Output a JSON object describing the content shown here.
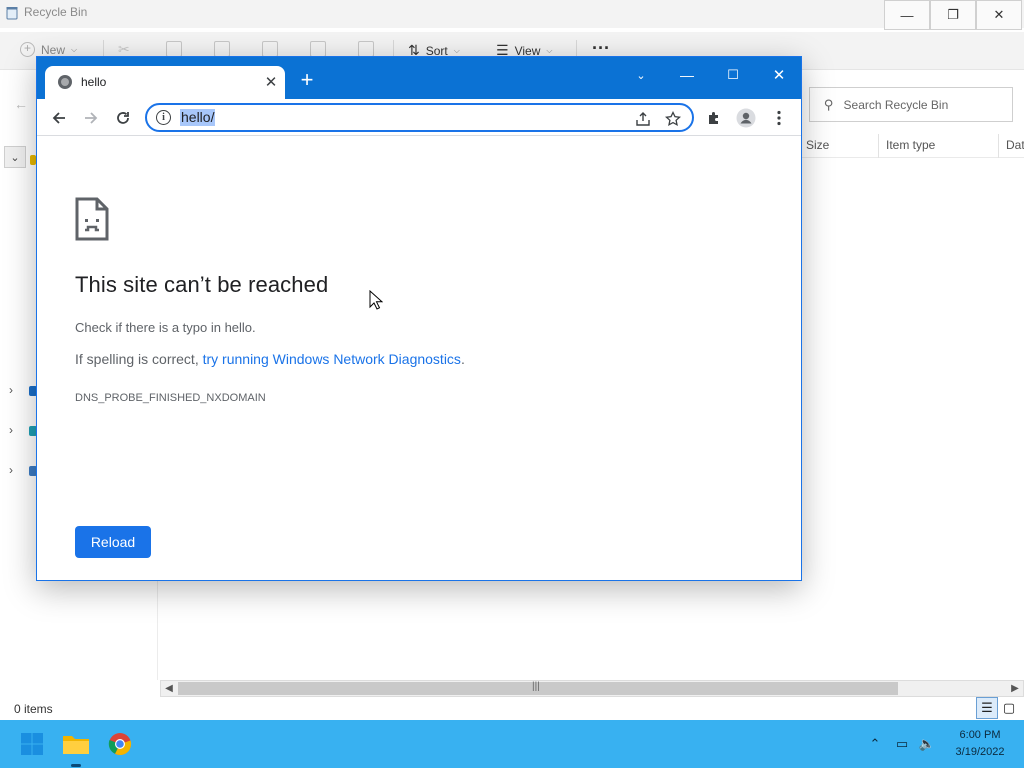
{
  "explorer": {
    "title": "Recycle Bin",
    "toolbar": {
      "new_label": "New",
      "sort_label": "Sort",
      "view_label": "View",
      "more_label": "···"
    },
    "search_placeholder": "Search Recycle Bin",
    "columns": [
      "Size",
      "Item type",
      "Dat"
    ],
    "status": "0 items"
  },
  "browser": {
    "tab_title": "hello",
    "url": "hello/",
    "accent": "#1a73e8",
    "titlebar_color": "#0b72d4"
  },
  "error": {
    "heading": "This site can’t be reached",
    "line1": "Check if there is a typo in hello.",
    "line2_prefix": "If spelling is correct, ",
    "line2_link": "try running Windows Network Diagnostics",
    "line2_suffix": ".",
    "code": "DNS_PROBE_FINISHED_NXDOMAIN",
    "reload_label": "Reload"
  },
  "taskbar": {
    "time": "6:00 PM",
    "date": "3/19/2022",
    "color": "#38b1f1"
  }
}
